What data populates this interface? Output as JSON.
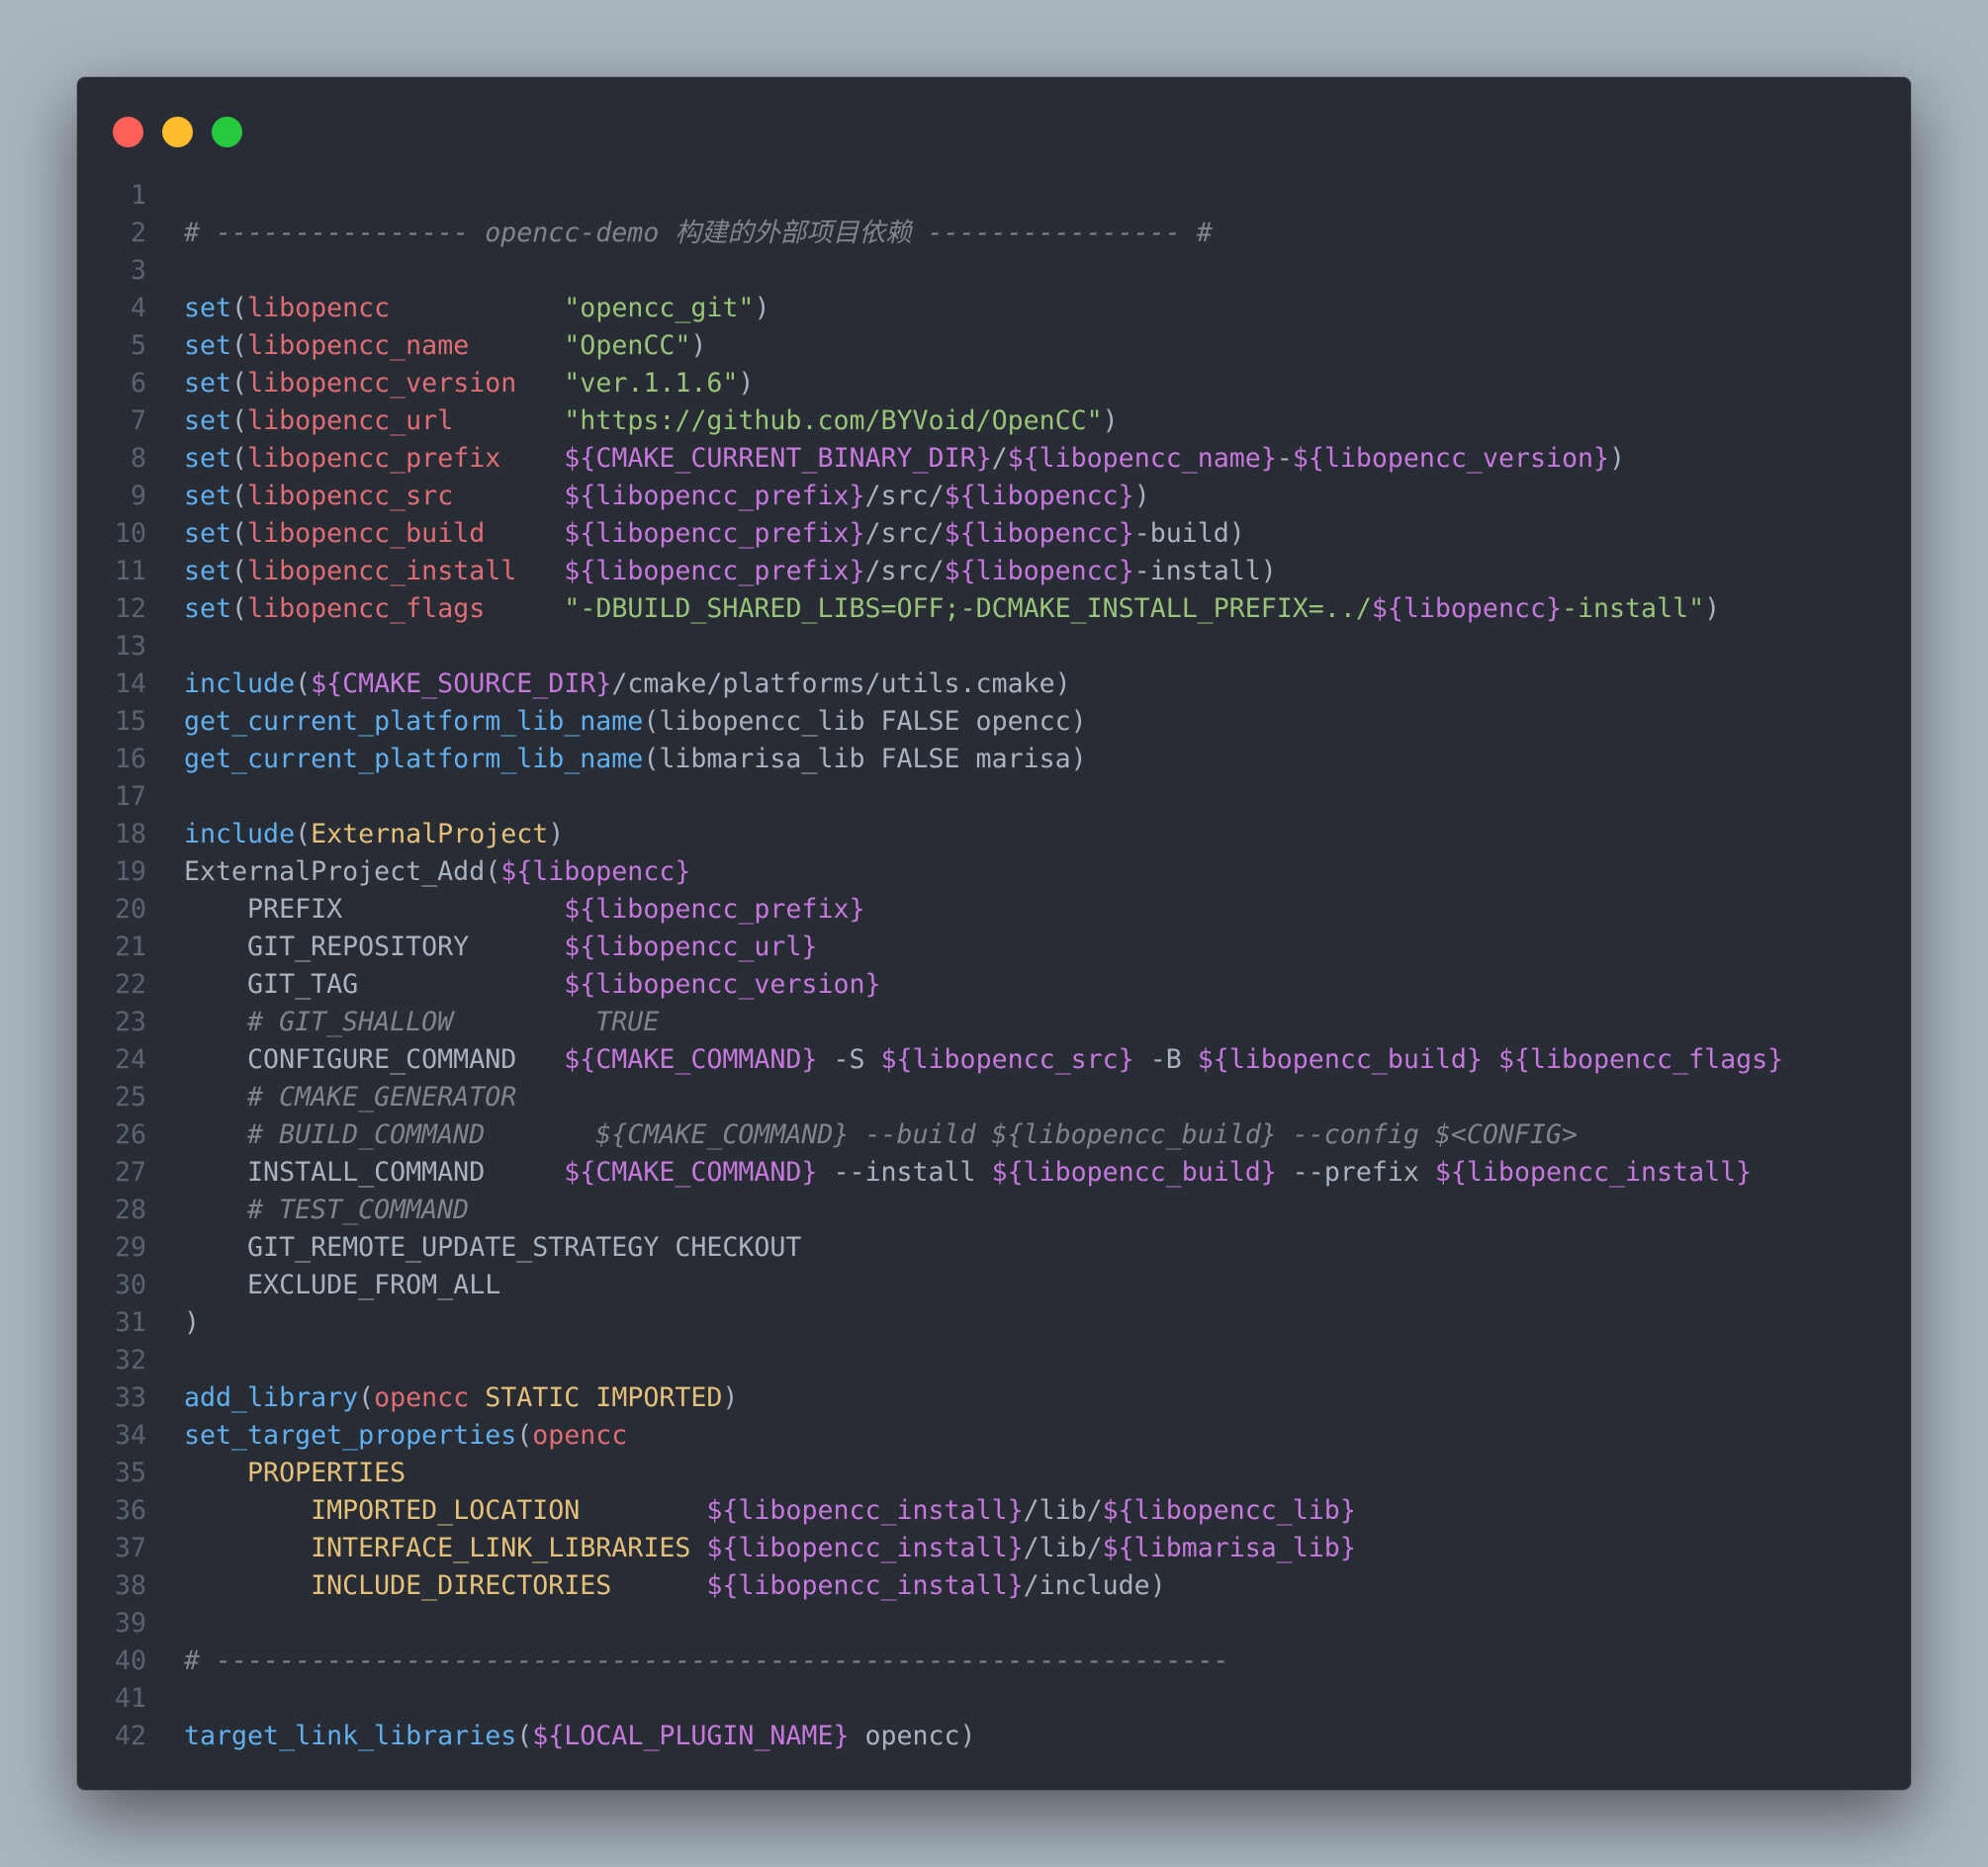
{
  "window": {
    "controls": [
      "close",
      "minimize",
      "maximize"
    ],
    "colors": {
      "close": "#ff5f56",
      "minimize": "#ffbd2e",
      "maximize": "#27c93f"
    }
  },
  "code": {
    "language": "cmake",
    "theme_colors": {
      "background": "#282c34",
      "text": "#abb2bf",
      "line_number": "#5c6370",
      "comment": "#7f848e",
      "function": "#61afef",
      "name": "#e06c75",
      "string": "#98c379",
      "variable": "#c678dd",
      "constant": "#e5c07b"
    },
    "lines": [
      {
        "n": "1",
        "t": []
      },
      {
        "n": "2",
        "t": [
          {
            "c": "comment",
            "v": "# ---------------- opencc-demo 构建的外部项目依赖 ---------------- #"
          }
        ]
      },
      {
        "n": "3",
        "t": []
      },
      {
        "n": "4",
        "t": [
          {
            "c": "func",
            "v": "set"
          },
          {
            "c": "plain",
            "v": "("
          },
          {
            "c": "name",
            "v": "libopencc"
          },
          {
            "c": "plain",
            "v": "           "
          },
          {
            "c": "string",
            "v": "\"opencc_git\""
          },
          {
            "c": "plain",
            "v": ")"
          }
        ]
      },
      {
        "n": "5",
        "t": [
          {
            "c": "func",
            "v": "set"
          },
          {
            "c": "plain",
            "v": "("
          },
          {
            "c": "name",
            "v": "libopencc_name"
          },
          {
            "c": "plain",
            "v": "      "
          },
          {
            "c": "string",
            "v": "\"OpenCC\""
          },
          {
            "c": "plain",
            "v": ")"
          }
        ]
      },
      {
        "n": "6",
        "t": [
          {
            "c": "func",
            "v": "set"
          },
          {
            "c": "plain",
            "v": "("
          },
          {
            "c": "name",
            "v": "libopencc_version"
          },
          {
            "c": "plain",
            "v": "   "
          },
          {
            "c": "string",
            "v": "\"ver.1.1.6\""
          },
          {
            "c": "plain",
            "v": ")"
          }
        ]
      },
      {
        "n": "7",
        "t": [
          {
            "c": "func",
            "v": "set"
          },
          {
            "c": "plain",
            "v": "("
          },
          {
            "c": "name",
            "v": "libopencc_url"
          },
          {
            "c": "plain",
            "v": "       "
          },
          {
            "c": "string",
            "v": "\"https://github.com/BYVoid/OpenCC\""
          },
          {
            "c": "plain",
            "v": ")"
          }
        ]
      },
      {
        "n": "8",
        "t": [
          {
            "c": "func",
            "v": "set"
          },
          {
            "c": "plain",
            "v": "("
          },
          {
            "c": "name",
            "v": "libopencc_prefix"
          },
          {
            "c": "plain",
            "v": "    "
          },
          {
            "c": "var",
            "v": "${CMAKE_CURRENT_BINARY_DIR}"
          },
          {
            "c": "plain",
            "v": "/"
          },
          {
            "c": "var",
            "v": "${libopencc_name}"
          },
          {
            "c": "plain",
            "v": "-"
          },
          {
            "c": "var",
            "v": "${libopencc_version}"
          },
          {
            "c": "plain",
            "v": ")"
          }
        ]
      },
      {
        "n": "9",
        "t": [
          {
            "c": "func",
            "v": "set"
          },
          {
            "c": "plain",
            "v": "("
          },
          {
            "c": "name",
            "v": "libopencc_src"
          },
          {
            "c": "plain",
            "v": "       "
          },
          {
            "c": "var",
            "v": "${libopencc_prefix}"
          },
          {
            "c": "plain",
            "v": "/src/"
          },
          {
            "c": "var",
            "v": "${libopencc}"
          },
          {
            "c": "plain",
            "v": ")"
          }
        ]
      },
      {
        "n": "10",
        "t": [
          {
            "c": "func",
            "v": "set"
          },
          {
            "c": "plain",
            "v": "("
          },
          {
            "c": "name",
            "v": "libopencc_build"
          },
          {
            "c": "plain",
            "v": "     "
          },
          {
            "c": "var",
            "v": "${libopencc_prefix}"
          },
          {
            "c": "plain",
            "v": "/src/"
          },
          {
            "c": "var",
            "v": "${libopencc}"
          },
          {
            "c": "plain",
            "v": "-build)"
          }
        ]
      },
      {
        "n": "11",
        "t": [
          {
            "c": "func",
            "v": "set"
          },
          {
            "c": "plain",
            "v": "("
          },
          {
            "c": "name",
            "v": "libopencc_install"
          },
          {
            "c": "plain",
            "v": "   "
          },
          {
            "c": "var",
            "v": "${libopencc_prefix}"
          },
          {
            "c": "plain",
            "v": "/src/"
          },
          {
            "c": "var",
            "v": "${libopencc}"
          },
          {
            "c": "plain",
            "v": "-install)"
          }
        ]
      },
      {
        "n": "12",
        "t": [
          {
            "c": "func",
            "v": "set"
          },
          {
            "c": "plain",
            "v": "("
          },
          {
            "c": "name",
            "v": "libopencc_flags"
          },
          {
            "c": "plain",
            "v": "     "
          },
          {
            "c": "string",
            "v": "\"-DBUILD_SHARED_LIBS=OFF;-DCMAKE_INSTALL_PREFIX=../"
          },
          {
            "c": "var",
            "v": "${libopencc}"
          },
          {
            "c": "string",
            "v": "-install\""
          },
          {
            "c": "plain",
            "v": ")"
          }
        ]
      },
      {
        "n": "13",
        "t": []
      },
      {
        "n": "14",
        "t": [
          {
            "c": "func",
            "v": "include"
          },
          {
            "c": "plain",
            "v": "("
          },
          {
            "c": "var",
            "v": "${CMAKE_SOURCE_DIR}"
          },
          {
            "c": "plain",
            "v": "/cmake/platforms/utils.cmake)"
          }
        ]
      },
      {
        "n": "15",
        "t": [
          {
            "c": "func",
            "v": "get_current_platform_lib_name"
          },
          {
            "c": "plain",
            "v": "(libopencc_lib FALSE opencc)"
          }
        ]
      },
      {
        "n": "16",
        "t": [
          {
            "c": "func",
            "v": "get_current_platform_lib_name"
          },
          {
            "c": "plain",
            "v": "(libmarisa_lib FALSE marisa)"
          }
        ]
      },
      {
        "n": "17",
        "t": []
      },
      {
        "n": "18",
        "t": [
          {
            "c": "func",
            "v": "include"
          },
          {
            "c": "plain",
            "v": "("
          },
          {
            "c": "const",
            "v": "ExternalProject"
          },
          {
            "c": "plain",
            "v": ")"
          }
        ]
      },
      {
        "n": "19",
        "t": [
          {
            "c": "plain",
            "v": "ExternalProject_Add("
          },
          {
            "c": "var",
            "v": "${libopencc}"
          }
        ]
      },
      {
        "n": "20",
        "t": [
          {
            "c": "plain",
            "v": "    PREFIX              "
          },
          {
            "c": "var",
            "v": "${libopencc_prefix}"
          }
        ]
      },
      {
        "n": "21",
        "t": [
          {
            "c": "plain",
            "v": "    GIT_REPOSITORY      "
          },
          {
            "c": "var",
            "v": "${libopencc_url}"
          }
        ]
      },
      {
        "n": "22",
        "t": [
          {
            "c": "plain",
            "v": "    GIT_TAG             "
          },
          {
            "c": "var",
            "v": "${libopencc_version}"
          }
        ]
      },
      {
        "n": "23",
        "t": [
          {
            "c": "plain",
            "v": "    "
          },
          {
            "c": "comment",
            "v": "# GIT_SHALLOW         TRUE"
          }
        ]
      },
      {
        "n": "24",
        "t": [
          {
            "c": "plain",
            "v": "    CONFIGURE_COMMAND   "
          },
          {
            "c": "var",
            "v": "${CMAKE_COMMAND}"
          },
          {
            "c": "plain",
            "v": " -S "
          },
          {
            "c": "var",
            "v": "${libopencc_src}"
          },
          {
            "c": "plain",
            "v": " -B "
          },
          {
            "c": "var",
            "v": "${libopencc_build}"
          },
          {
            "c": "plain",
            "v": " "
          },
          {
            "c": "var",
            "v": "${libopencc_flags}"
          }
        ]
      },
      {
        "n": "25",
        "t": [
          {
            "c": "plain",
            "v": "    "
          },
          {
            "c": "comment",
            "v": "# CMAKE_GENERATOR"
          }
        ]
      },
      {
        "n": "26",
        "t": [
          {
            "c": "plain",
            "v": "    "
          },
          {
            "c": "comment",
            "v": "# BUILD_COMMAND       ${CMAKE_COMMAND} --build ${libopencc_build} --config $<CONFIG>"
          }
        ]
      },
      {
        "n": "27",
        "t": [
          {
            "c": "plain",
            "v": "    INSTALL_COMMAND     "
          },
          {
            "c": "var",
            "v": "${CMAKE_COMMAND}"
          },
          {
            "c": "plain",
            "v": " --install "
          },
          {
            "c": "var",
            "v": "${libopencc_build}"
          },
          {
            "c": "plain",
            "v": " --prefix "
          },
          {
            "c": "var",
            "v": "${libopencc_install}"
          }
        ]
      },
      {
        "n": "28",
        "t": [
          {
            "c": "plain",
            "v": "    "
          },
          {
            "c": "comment",
            "v": "# TEST_COMMAND"
          }
        ]
      },
      {
        "n": "29",
        "t": [
          {
            "c": "plain",
            "v": "    GIT_REMOTE_UPDATE_STRATEGY CHECKOUT"
          }
        ]
      },
      {
        "n": "30",
        "t": [
          {
            "c": "plain",
            "v": "    EXCLUDE_FROM_ALL"
          }
        ]
      },
      {
        "n": "31",
        "t": [
          {
            "c": "plain",
            "v": ")"
          }
        ]
      },
      {
        "n": "32",
        "t": []
      },
      {
        "n": "33",
        "t": [
          {
            "c": "func",
            "v": "add_library"
          },
          {
            "c": "plain",
            "v": "("
          },
          {
            "c": "name",
            "v": "opencc"
          },
          {
            "c": "plain",
            "v": " "
          },
          {
            "c": "const",
            "v": "STATIC IMPORTED"
          },
          {
            "c": "plain",
            "v": ")"
          }
        ]
      },
      {
        "n": "34",
        "t": [
          {
            "c": "func",
            "v": "set_target_properties"
          },
          {
            "c": "plain",
            "v": "("
          },
          {
            "c": "name",
            "v": "opencc"
          }
        ]
      },
      {
        "n": "35",
        "t": [
          {
            "c": "plain",
            "v": "    "
          },
          {
            "c": "const",
            "v": "PROPERTIES"
          }
        ]
      },
      {
        "n": "36",
        "t": [
          {
            "c": "plain",
            "v": "        "
          },
          {
            "c": "const",
            "v": "IMPORTED_LOCATION"
          },
          {
            "c": "plain",
            "v": "        "
          },
          {
            "c": "var",
            "v": "${libopencc_install}"
          },
          {
            "c": "plain",
            "v": "/lib/"
          },
          {
            "c": "var",
            "v": "${libopencc_lib}"
          }
        ]
      },
      {
        "n": "37",
        "t": [
          {
            "c": "plain",
            "v": "        "
          },
          {
            "c": "const",
            "v": "INTERFACE_LINK_LIBRARIES"
          },
          {
            "c": "plain",
            "v": " "
          },
          {
            "c": "var",
            "v": "${libopencc_install}"
          },
          {
            "c": "plain",
            "v": "/lib/"
          },
          {
            "c": "var",
            "v": "${libmarisa_lib}"
          }
        ]
      },
      {
        "n": "38",
        "t": [
          {
            "c": "plain",
            "v": "        "
          },
          {
            "c": "const",
            "v": "INCLUDE_DIRECTORIES"
          },
          {
            "c": "plain",
            "v": "      "
          },
          {
            "c": "var",
            "v": "${libopencc_install}"
          },
          {
            "c": "plain",
            "v": "/include)"
          }
        ]
      },
      {
        "n": "39",
        "t": []
      },
      {
        "n": "40",
        "t": [
          {
            "c": "comment",
            "v": "# ----------------------------------------------------------------"
          }
        ]
      },
      {
        "n": "41",
        "t": []
      },
      {
        "n": "42",
        "t": [
          {
            "c": "func",
            "v": "target_link_libraries"
          },
          {
            "c": "plain",
            "v": "("
          },
          {
            "c": "var",
            "v": "${LOCAL_PLUGIN_NAME}"
          },
          {
            "c": "plain",
            "v": " opencc)"
          }
        ]
      }
    ]
  }
}
